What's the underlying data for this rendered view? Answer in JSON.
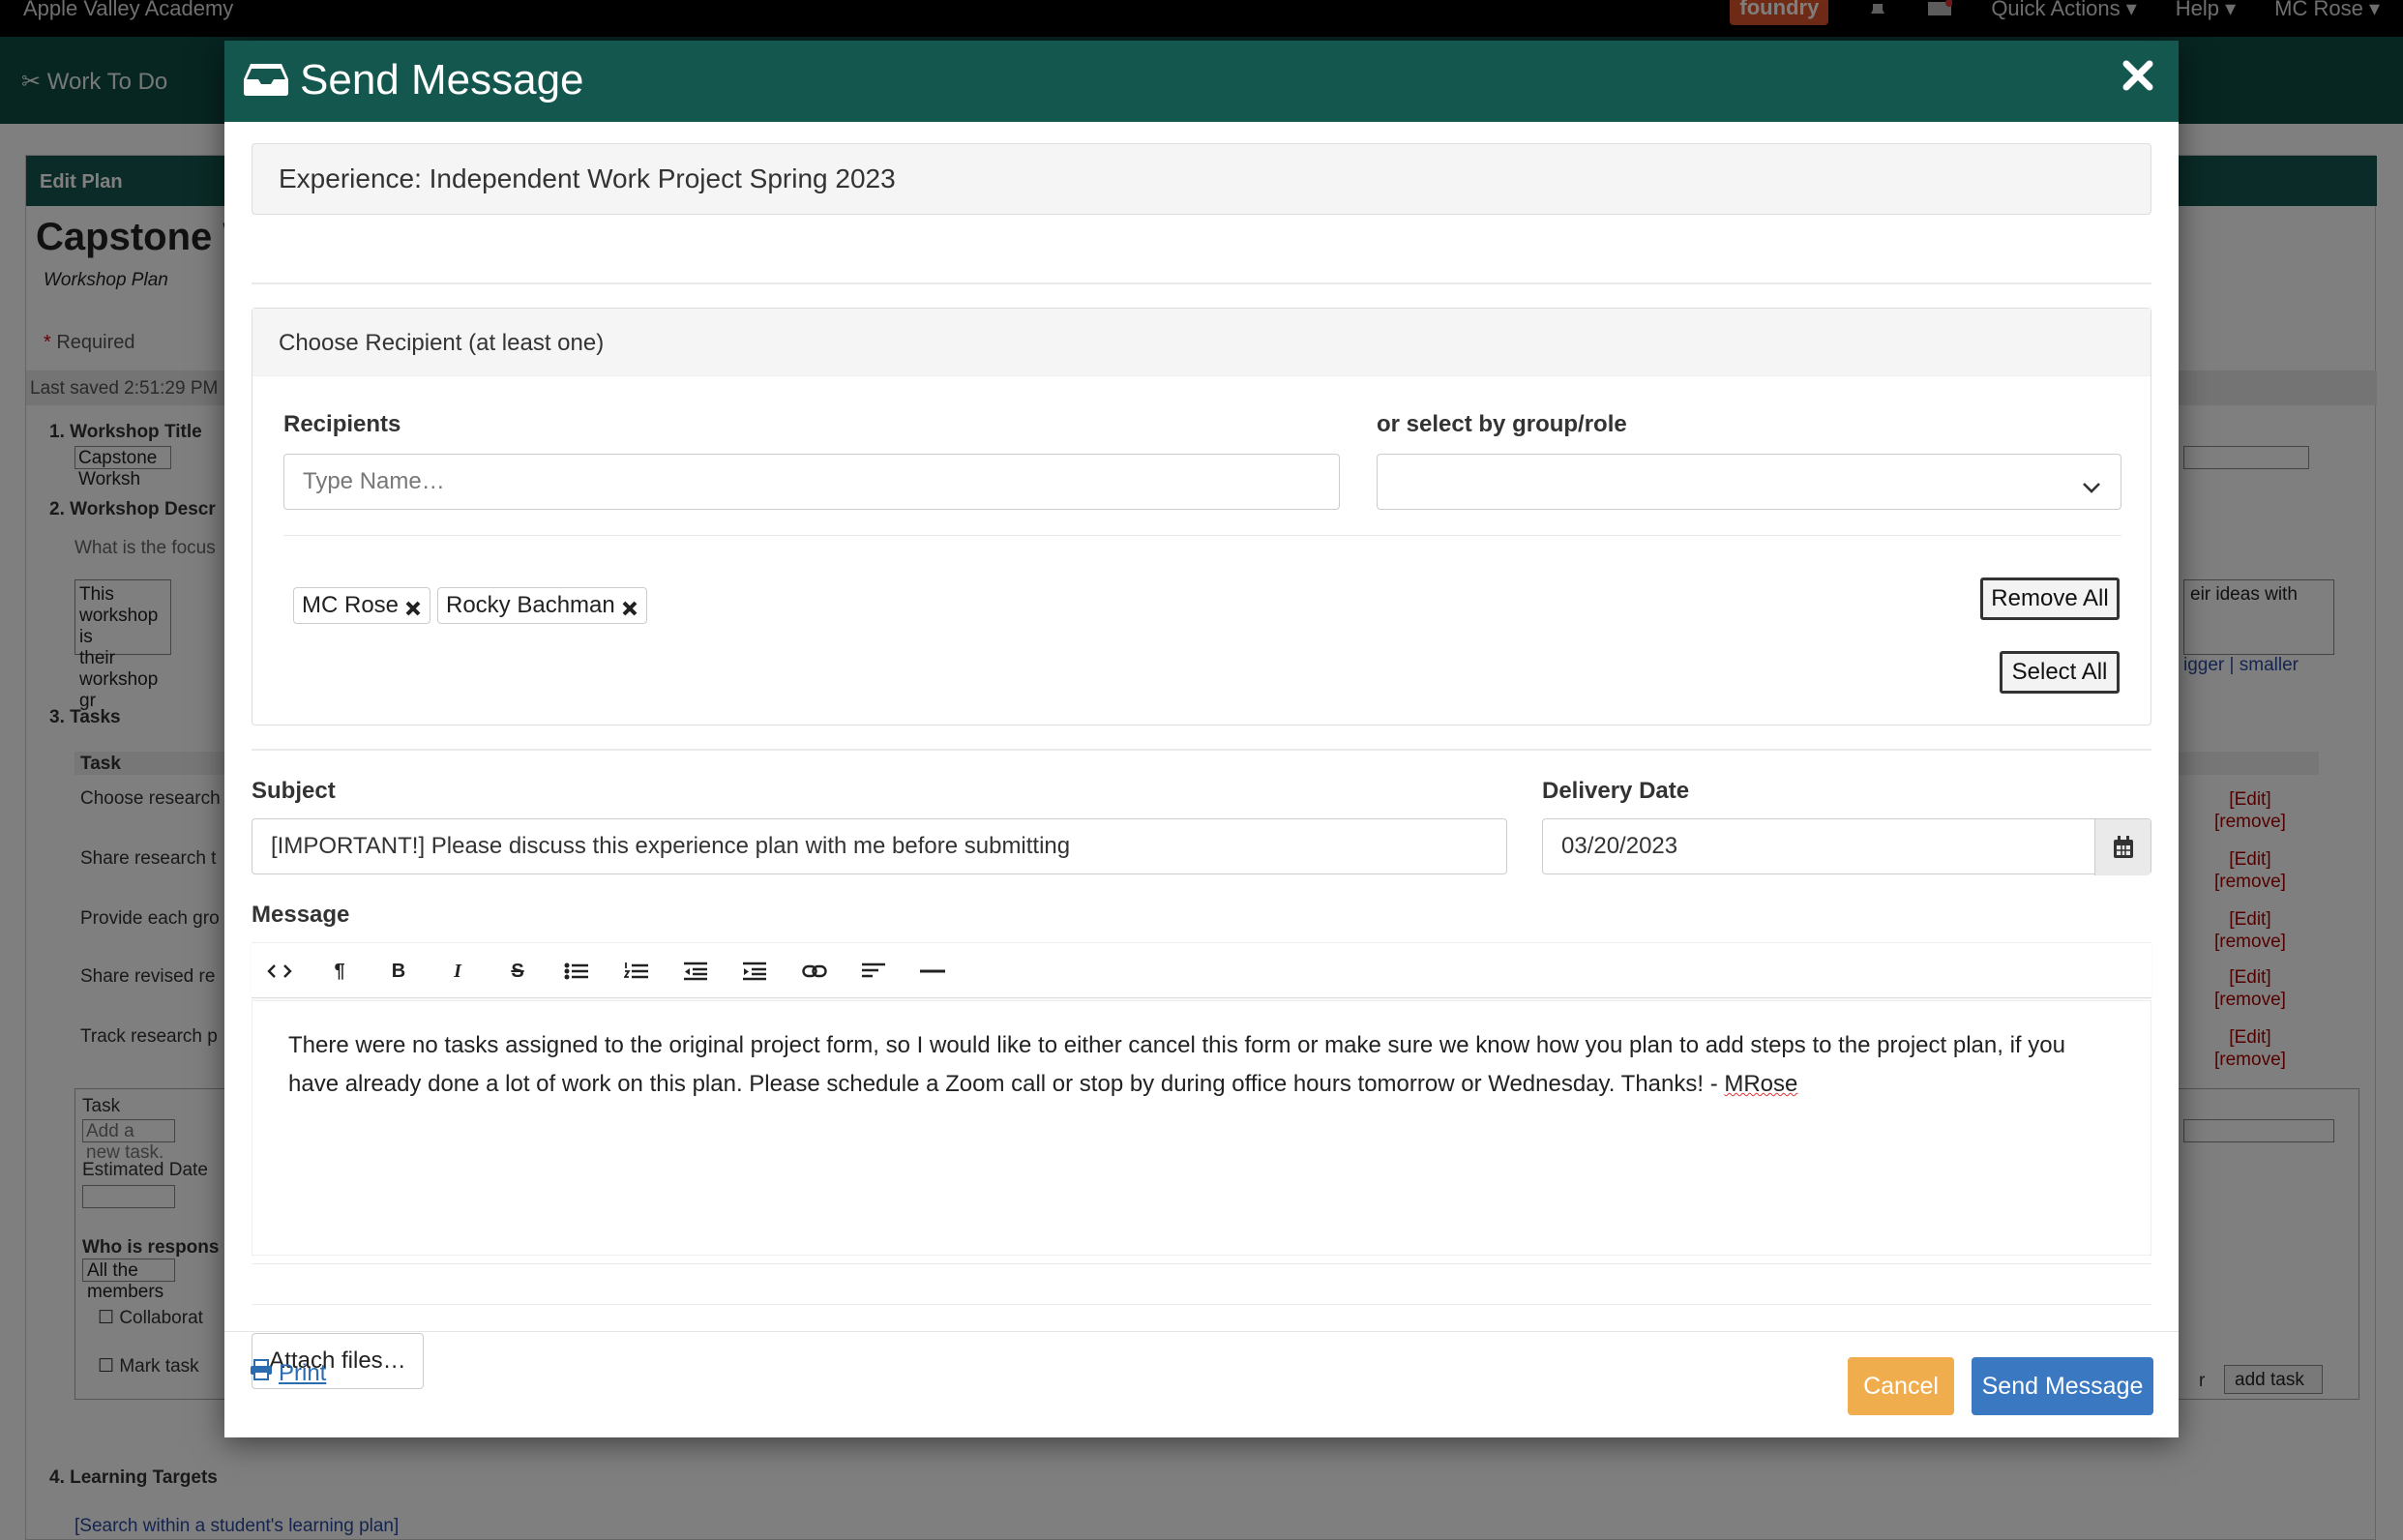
{
  "background": {
    "org": "Apple Valley Academy",
    "brand_badge": "foundry",
    "quick_actions": "Quick Actions",
    "help": "Help",
    "user": "MC Rose",
    "work_to_do": "Work To Do",
    "edit_plan": "Edit Plan",
    "page_title": "Capstone W",
    "page_subtitle": "Workshop Plan",
    "required": "Required",
    "last_saved": "Last saved  2:51:29 PM",
    "sections": {
      "s1": "1.  Workshop Title",
      "s1_value": "Capstone Worksh",
      "s2": "2.  Workshop Descr",
      "s2_hint": "What is the focus",
      "s2_text_1": "This workshop is",
      "s2_text_2": "their workshop gr",
      "s2_right": "eir ideas with",
      "bigger": "igger",
      "sep": "|",
      "smaller": "smaller",
      "s3": "3.  Tasks",
      "task_col": "Task",
      "tasks": [
        "Choose research",
        "Share research t",
        "Provide each gro",
        "Share revised re",
        "Track research p"
      ],
      "edit": "[Edit]",
      "remove": "[remove]",
      "new_task_label": "Task",
      "new_task_ph": "Add a new task.",
      "est_date": "Estimated Date",
      "who_resp": "Who is respons",
      "all_members": "All the members",
      "collab": "Collaborat",
      "mark_task": "Mark task",
      "r_letter": "r",
      "add_task": "add task",
      "s4": "4.  Learning Targets",
      "search_link": "[Search within a student's learning plan]"
    }
  },
  "modal": {
    "title": "Send Message",
    "experience": "Experience: Independent Work Project Spring 2023",
    "recipient_card_title": "Choose Recipient (at least one)",
    "recipients_label": "Recipients",
    "recipients_placeholder": "Type Name…",
    "group_label": "or select by group/role",
    "group_value": "",
    "chips": [
      "MC Rose",
      "Rocky Bachman"
    ],
    "remove_all": "Remove All",
    "select_all": "Select All",
    "subject_label": "Subject",
    "subject_value": "[IMPORTANT!] Please discuss this experience plan with me before submitting",
    "delivery_label": "Delivery Date",
    "delivery_value": "03/20/2023",
    "message_label": "Message",
    "message_body": "There were no tasks assigned to the original project form, so I would like to either cancel this form or make sure we know how you plan to add steps to the project plan, if you have already done a lot of work on this plan. Please schedule a Zoom call or stop by during office hours tomorrow or Wednesday. Thanks! - ",
    "message_signature": "MRose",
    "attach": "Attach files…",
    "print": "Print",
    "cancel": "Cancel",
    "send": "Send Message"
  },
  "colors": {
    "header_green": "#14574e",
    "cancel_orange": "#f0ad4e",
    "send_blue": "#3a78c2"
  }
}
